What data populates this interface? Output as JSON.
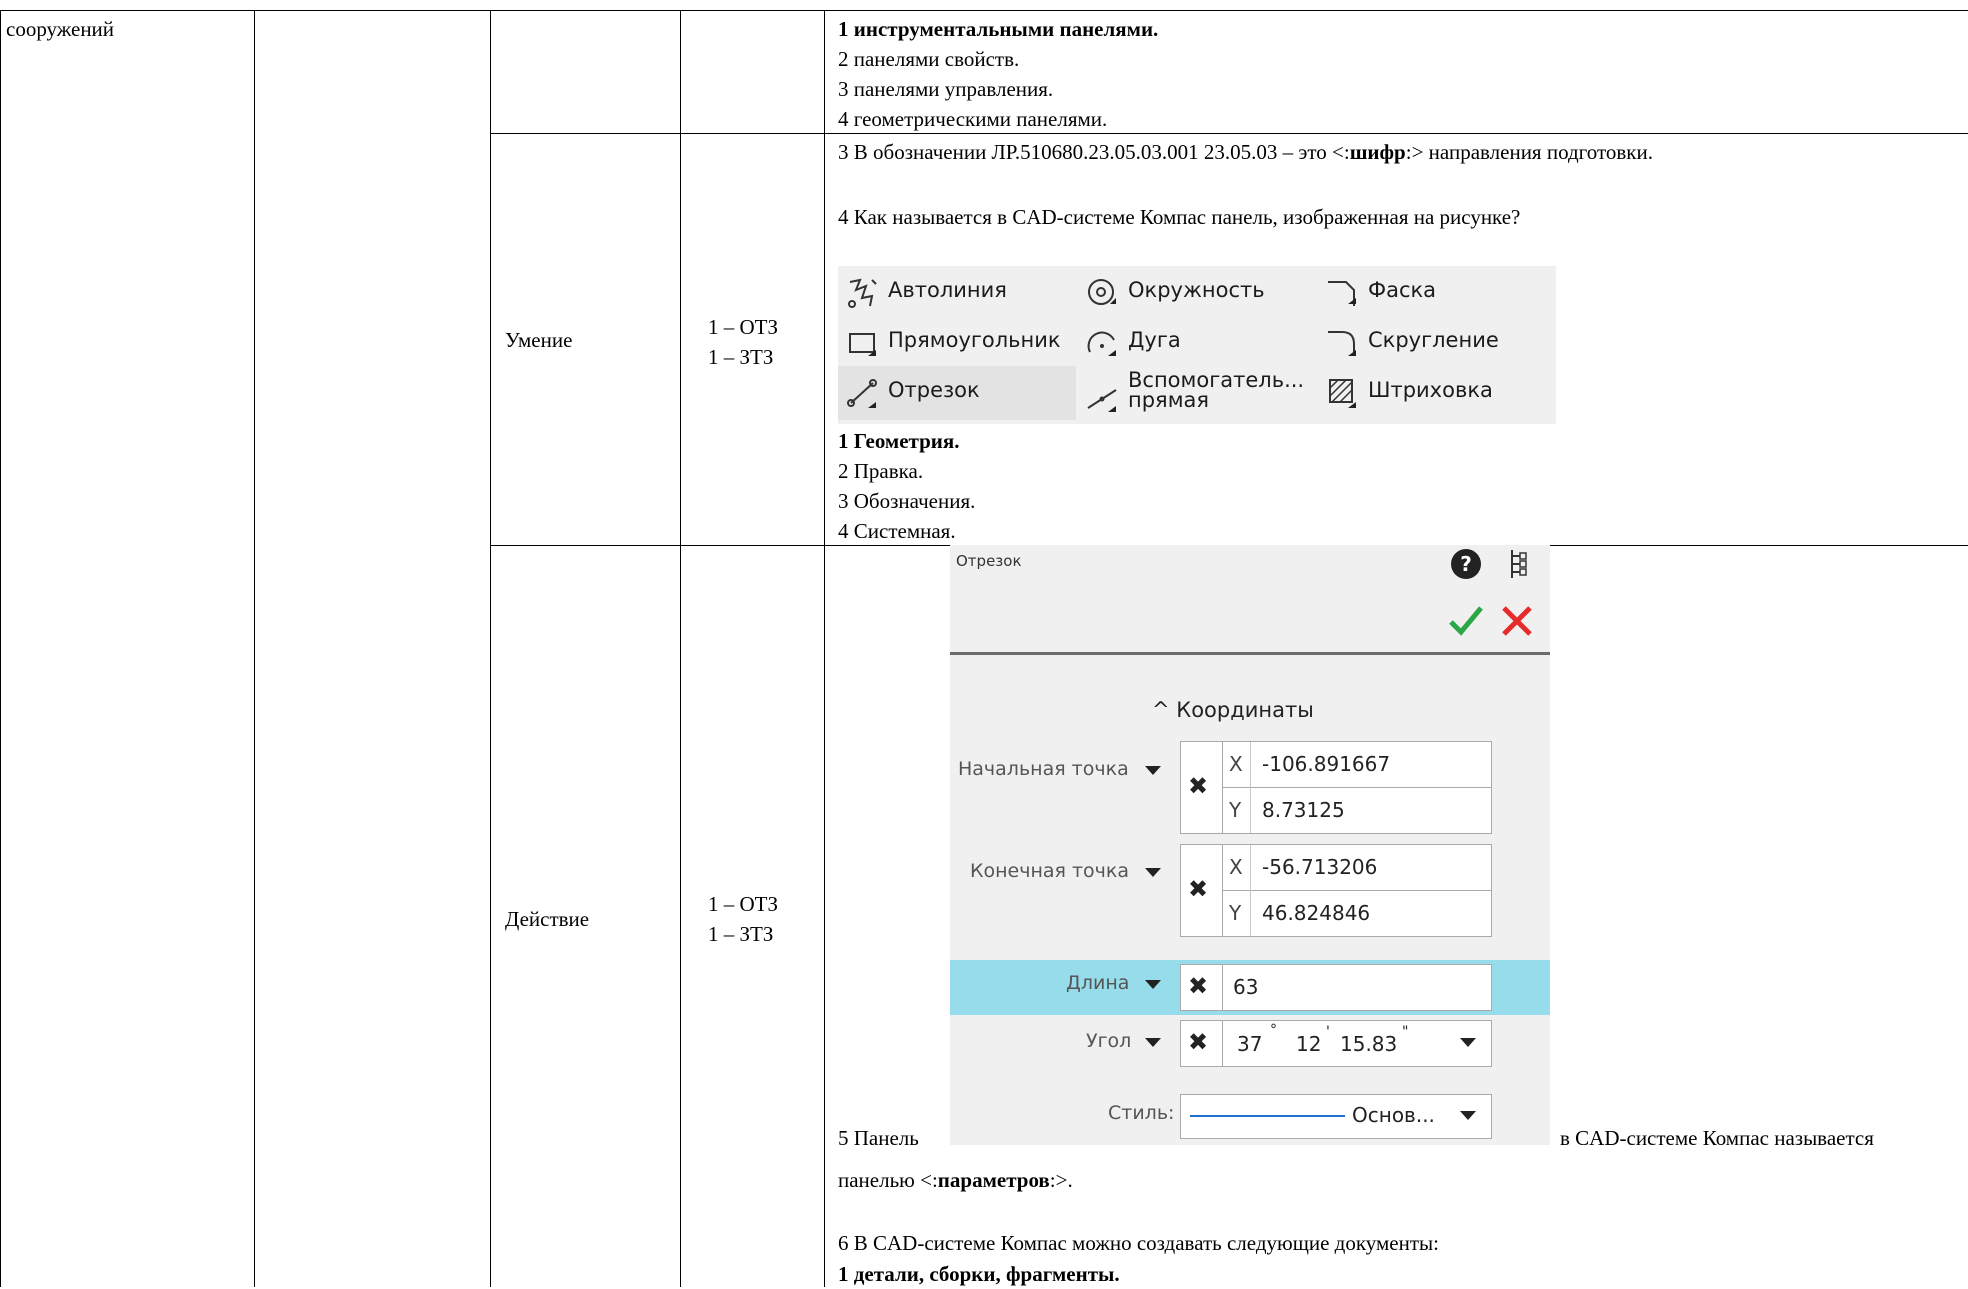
{
  "table": {
    "col1_text": "сооружений",
    "row_umenie": {
      "category": "Умение",
      "tasks_line1": "1 – ОТЗ",
      "tasks_line2": "1 – ЗТЗ"
    },
    "row_deystvie": {
      "category": "Действие",
      "tasks_line1": "1 – ОТЗ",
      "tasks_line2": "1 – ЗТЗ"
    }
  },
  "q2_options": [
    "1 инструментальными панелями.",
    "2 панелями свойств.",
    "3 панелями управления.",
    "4 геометрическими панелями."
  ],
  "q3": {
    "prefix": "3 В обозначении ЛР.510680.23.05.03.001 23.05.03 – это <:",
    "answer": "шифр",
    "suffix": ":> направления подготовки."
  },
  "q4": {
    "text": "4 Как называется в CAD-системе Компас панель, изображенная на рисунке?",
    "options": [
      "1 Геометрия.",
      "2 Правка.",
      "3 Обозначения.",
      "4 Системная."
    ]
  },
  "toolbar": {
    "autoline": "Автолиния",
    "circle": "Окружность",
    "chamfer": "Фаска",
    "rectangle": "Прямоугольник",
    "arc": "Дуга",
    "fillet": "Скругление",
    "segment": "Отрезок",
    "aux_line_1": "Вспомогатель...",
    "aux_line_2": "прямая",
    "hatch": "Штриховка"
  },
  "panel": {
    "title": "Отрезок",
    "section": "Координаты",
    "start_label": "Начальная точка",
    "end_label": "Конечная точка",
    "x_letter": "X",
    "y_letter": "Y",
    "start_x": "-106.891667",
    "start_y": "8.73125",
    "end_x": "-56.713206",
    "end_y": "46.824846",
    "length_label": "Длина",
    "length_value": "63",
    "angle_label": "Угол",
    "angle_deg": "37",
    "angle_min": "12",
    "angle_sec": "15.83",
    "style_label": "Стиль:",
    "style_value": "Основ...",
    "highlight_color": "#96dcea",
    "ok_color": "#2aa845",
    "cancel_color": "#e52b2b"
  },
  "q5": {
    "prefix": "5 Панель",
    "suffix": "в CAD-системе Компас называется",
    "line2_prefix": "панелью <:",
    "answer": "параметров",
    "line2_suffix": ":>."
  },
  "q6": {
    "text": "6 В CAD-системе Компас можно создавать следующие документы:",
    "option1": "1 детали, сборки, фрагменты."
  }
}
